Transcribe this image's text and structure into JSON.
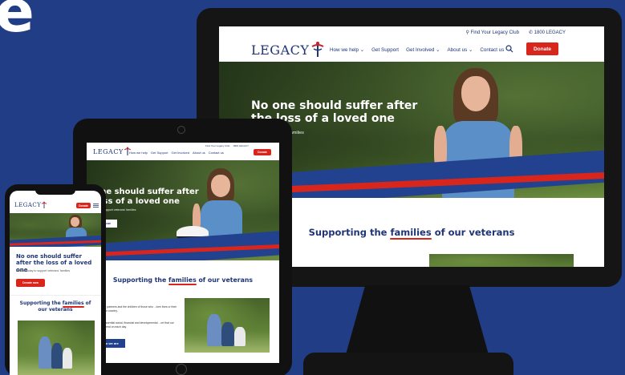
{
  "backdrop": {
    "partial_heading": "e",
    "color": "#203d85"
  },
  "brand": {
    "logo_text": "LEGACY",
    "primary_color": "#1f3574",
    "accent_color": "#d9261c",
    "wave_color": "#22428f"
  },
  "desktop": {
    "topbar": {
      "find_club": "Find Your Legacy Club",
      "phone": "1800 LEGACY"
    },
    "nav": [
      "How we help",
      "Get Support",
      "Get Involved",
      "About us",
      "Contact us"
    ],
    "donate_label": "Donate",
    "hero": {
      "title_line1": "No one should suffer after",
      "title_line2": "the loss of a loved one",
      "subtitle": "...port veterans' families"
    },
    "section_title_before": "Supporting the",
    "section_title_highlight": "families",
    "section_title_after": "of our veterans"
  },
  "tablet": {
    "nav": [
      "How we help",
      "Get Support",
      "Get Involved",
      "About us",
      "Contact us"
    ],
    "donate_label": "Donate",
    "topbar": {
      "find_club": "Find Your Legacy Club",
      "phone": "1800 LEGACY"
    },
    "hero": {
      "title_line1": "o one should suffer after",
      "title_line2": "e loss of a loved one",
      "subtitle": "...today to support veterans' families",
      "cta": "...ate now"
    },
    "section_title_before": "Supporting the",
    "section_title_highlight": "families",
    "section_title_after": "of our veterans",
    "body_1": "...are for the partners and the children of those who ...iven lives or their health for our country.",
    "body_2": "...vide the essential social, financial and developmental ...ort that our families depend on each day.",
    "cta": "...ho we are"
  },
  "phone": {
    "donate_label": "Donate",
    "hero": {
      "title": "No one should suffer after the loss of a loved one",
      "subtitle": "Donate today to support veterans' families",
      "cta": "Donate now"
    },
    "section_title_before": "Supporting the",
    "section_title_highlight": "families",
    "section_title_after": "of our veterans"
  }
}
